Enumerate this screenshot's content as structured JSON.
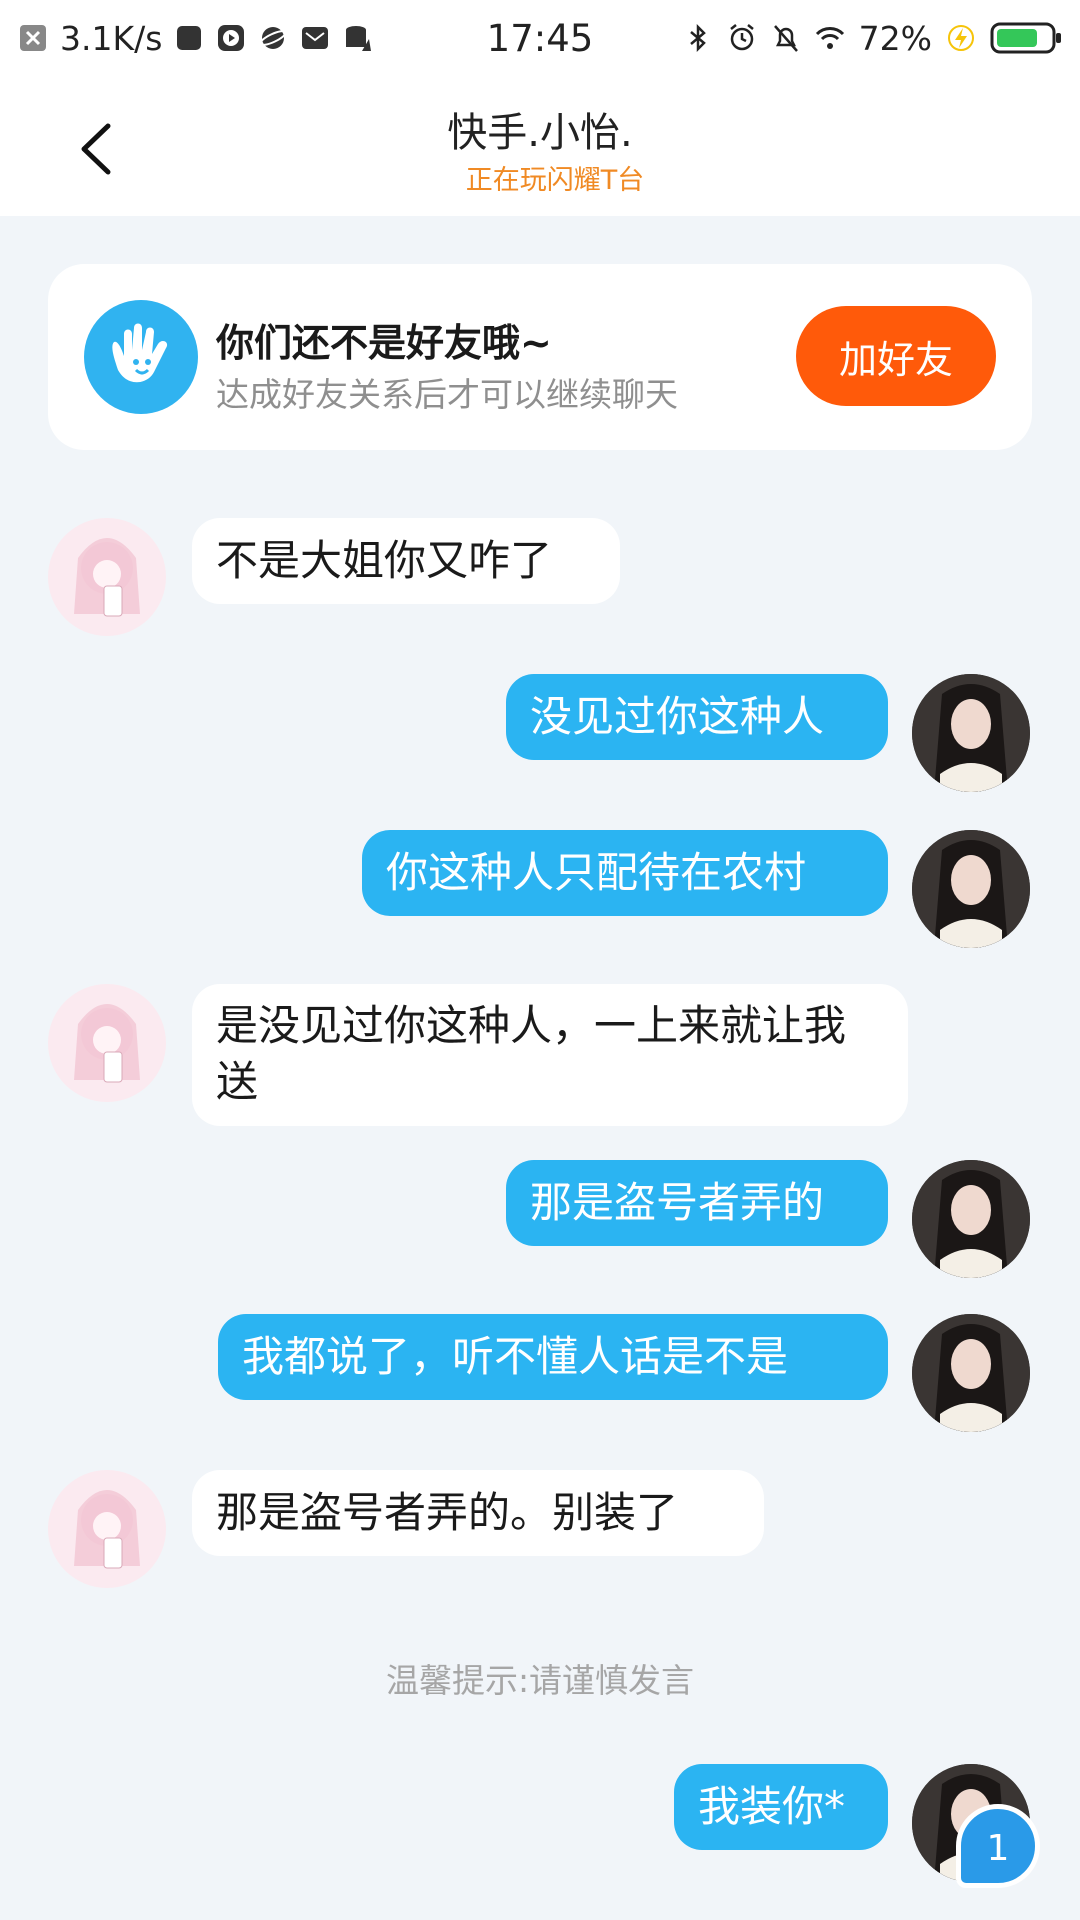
{
  "status_bar": {
    "net_speed": "3.1K/s",
    "time": "17:45",
    "battery": "72%"
  },
  "header": {
    "title": "快手.小怡.",
    "subtitle": "正在玩闪耀T台"
  },
  "friend_card": {
    "title": "你们还不是好友哦~",
    "subtitle": "达成好友关系后才可以继续聊天",
    "button": "加好友"
  },
  "messages": [
    {
      "side": "left",
      "text": "不是大姐你又咋了"
    },
    {
      "side": "right",
      "text": "没见过你这种人"
    },
    {
      "side": "right",
      "text": "你这种人只配待在农村"
    },
    {
      "side": "left",
      "text": "是没见过你这种人，一上来就让我送"
    },
    {
      "side": "right",
      "text": "那是盗号者弄的"
    },
    {
      "side": "right",
      "text": "我都说了，听不懂人话是不是"
    },
    {
      "side": "left",
      "text": "那是盗号者弄的。别装了"
    },
    {
      "side": "right",
      "text": "我装你*"
    }
  ],
  "notice": "温馨提示:请谨慎发言",
  "unread_badge": "1",
  "colors": {
    "accent_blue": "#2bb4f2",
    "button_orange": "#ff5a0a",
    "subtitle_orange": "#f08a24"
  },
  "icons": [
    "back-arrow-icon",
    "hand-wave-icon",
    "bluetooth-icon",
    "alarm-icon",
    "mute-bell-icon",
    "wifi-icon",
    "battery-icon",
    "charging-icon"
  ]
}
